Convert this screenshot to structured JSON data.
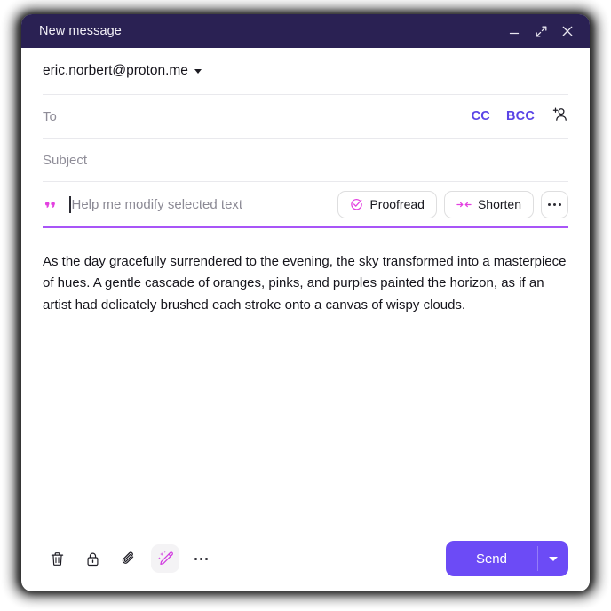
{
  "window": {
    "title": "New message",
    "controls": [
      {
        "name": "minimize",
        "icon": "minimize-icon"
      },
      {
        "name": "maximize",
        "icon": "expand-icon"
      },
      {
        "name": "close",
        "icon": "close-icon"
      }
    ]
  },
  "compose": {
    "from": {
      "address": "eric.norbert@proton.me"
    },
    "to": {
      "placeholder": "To",
      "cc_label": "CC",
      "bcc_label": "BCC",
      "contacts_icon": "add-contact-icon"
    },
    "subject": {
      "placeholder": "Subject"
    },
    "assistant": {
      "quote_icon": "quote-icon",
      "placeholder": "Help me modify selected text",
      "proofread_label": "Proofread",
      "proofread_icon": "spellcheck-icon",
      "shorten_label": "Shorten",
      "shorten_icon": "shorten-arrows-icon",
      "more_icon": "ellipsis-icon"
    },
    "body": {
      "text": "As the day gracefully surrendered to the evening, the sky transformed into a masterpiece of hues. A gentle cascade of oranges, pinks, and purples painted the horizon, as if an artist had delicately brushed each stroke onto a canvas of wispy clouds."
    }
  },
  "footer": {
    "tools": [
      {
        "name": "delete-draft",
        "icon": "trash-icon"
      },
      {
        "name": "encryption",
        "icon": "lock-icon"
      },
      {
        "name": "attachment",
        "icon": "paperclip-icon"
      },
      {
        "name": "writing-assistant",
        "icon": "magic-wand-icon"
      },
      {
        "name": "more-options",
        "icon": "ellipsis-icon"
      }
    ],
    "send_label": "Send",
    "send_caret_icon": "chevron-down-icon"
  },
  "colors": {
    "titlebar": "#2A2153",
    "accent_send": "#6C4BF6",
    "link": "#5A44E6",
    "assistant_underline": "#A855F7",
    "magenta": "#E040E0"
  }
}
